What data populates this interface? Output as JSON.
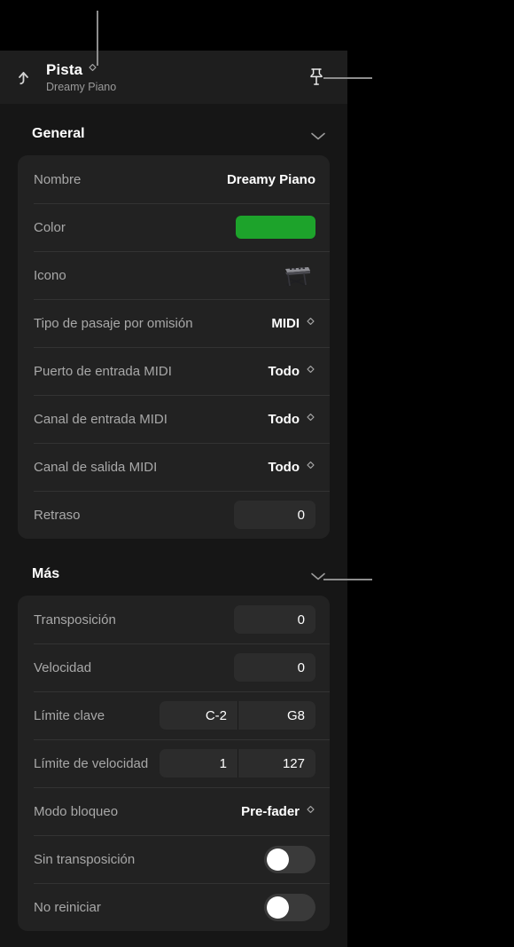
{
  "colors": {
    "panel_bg": "#161616",
    "card_bg": "#222222",
    "header_bg": "#1e1e1e",
    "field_bg": "#2c2c2c",
    "track_color": "#1da32b",
    "callout": "#8d8d8d"
  },
  "header": {
    "back_icon": "arrow-up-back-icon",
    "title": "Pista",
    "subtitle": "Dreamy Piano",
    "stepper_icon": "up-down-stepper-icon",
    "pin_icon": "pin-icon"
  },
  "sections": [
    {
      "id": "general",
      "title": "General",
      "chevron_icon": "chevron-down-icon",
      "rows": [
        {
          "name": "nombre",
          "label": "Nombre",
          "type": "text",
          "value": "Dreamy Piano"
        },
        {
          "name": "color",
          "label": "Color",
          "type": "swatch",
          "value": "#1da32b"
        },
        {
          "name": "icono",
          "label": "Icono",
          "type": "icon",
          "value": "keyboard-stand-icon"
        },
        {
          "name": "tipo-pasaje",
          "label": "Tipo de pasaje por omisión",
          "type": "popup",
          "value": "MIDI"
        },
        {
          "name": "puerto-entrada-midi",
          "label": "Puerto de entrada MIDI",
          "type": "popup",
          "value": "Todo"
        },
        {
          "name": "canal-entrada-midi",
          "label": "Canal de entrada MIDI",
          "type": "popup",
          "value": "Todo"
        },
        {
          "name": "canal-salida-midi",
          "label": "Canal de salida MIDI",
          "type": "popup",
          "value": "Todo"
        },
        {
          "name": "retraso",
          "label": "Retraso",
          "type": "number",
          "value": "0"
        }
      ]
    },
    {
      "id": "mas",
      "title": "Más",
      "chevron_icon": "chevron-down-icon",
      "rows": [
        {
          "name": "transposicion",
          "label": "Transposición",
          "type": "number",
          "value": "0"
        },
        {
          "name": "velocidad",
          "label": "Velocidad",
          "type": "number",
          "value": "0"
        },
        {
          "name": "limite-clave",
          "label": "Límite clave",
          "type": "range",
          "value_low": "C-2",
          "value_high": "G8"
        },
        {
          "name": "limite-velocidad",
          "label": "Límite de velocidad",
          "type": "range",
          "value_low": "1",
          "value_high": "127"
        },
        {
          "name": "modo-bloqueo",
          "label": "Modo bloqueo",
          "type": "popup",
          "value": "Pre-fader"
        },
        {
          "name": "sin-transposicion",
          "label": "Sin transposición",
          "type": "toggle",
          "value": "off"
        },
        {
          "name": "no-reiniciar",
          "label": "No reiniciar",
          "type": "toggle",
          "value": "off"
        }
      ]
    }
  ]
}
